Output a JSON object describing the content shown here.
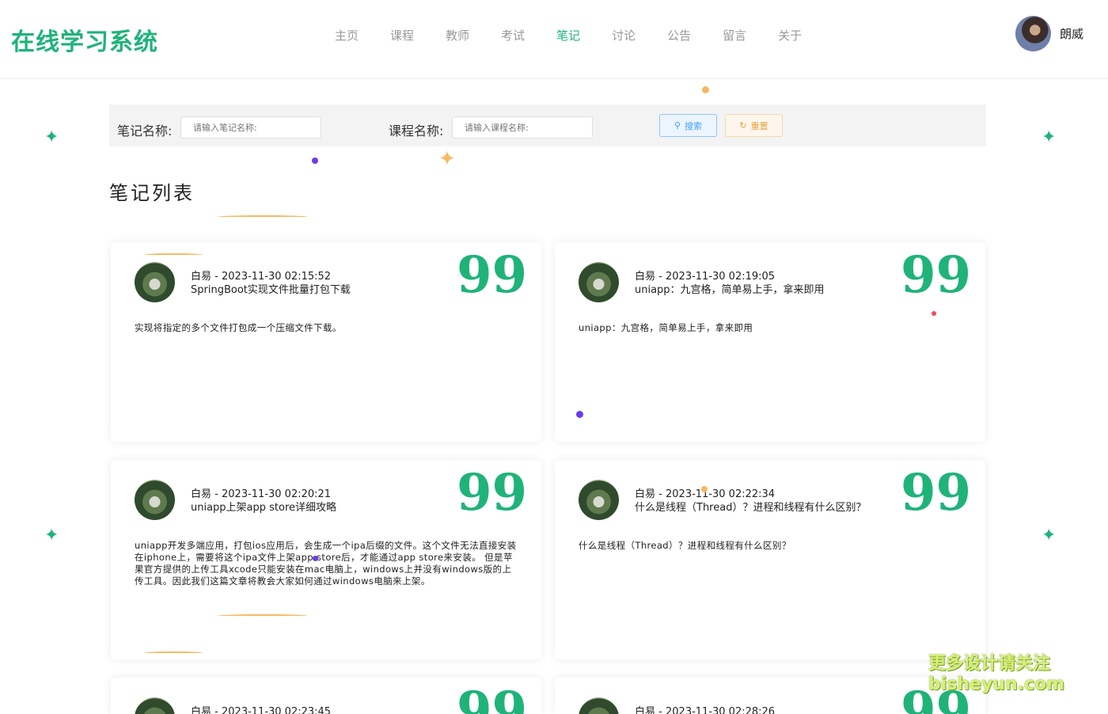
{
  "header": {
    "logo": "在线学习系统",
    "nav": [
      {
        "label": "主页",
        "active": false
      },
      {
        "label": "课程",
        "active": false
      },
      {
        "label": "教师",
        "active": false
      },
      {
        "label": "考试",
        "active": false
      },
      {
        "label": "笔记",
        "active": true
      },
      {
        "label": "讨论",
        "active": false
      },
      {
        "label": "公告",
        "active": false
      },
      {
        "label": "留言",
        "active": false
      },
      {
        "label": "关于",
        "active": false
      }
    ],
    "username": "朗威"
  },
  "search": {
    "note_label": "笔记名称:",
    "note_placeholder": "请输入笔记名称:",
    "course_label": "课程名称:",
    "course_placeholder": "请输入课程名称:",
    "search_button": "搜索",
    "reset_button": "重置"
  },
  "section_title": "笔记列表",
  "cards": [
    {
      "author": "白易",
      "time": "2023-11-30 02:15:52",
      "title": "SpringBoot实现文件批量打包下载",
      "content": "实现将指定的多个文件打包成一个压缩文件下载。"
    },
    {
      "author": "白易",
      "time": "2023-11-30 02:19:05",
      "title": "uniapp：九宫格，简单易上手，拿来即用",
      "content": "uniapp：九宫格，简单易上手，拿来即用"
    },
    {
      "author": "白易",
      "time": "2023-11-30 02:20:21",
      "title": "uniapp上架app store详细攻略",
      "content": "uniapp开发多端应用，打包ios应用后，会生成一个ipa后缀的文件。这个文件无法直接安装在iphone上，需要将这个ipa文件上架app store后，才能通过app store来安装。 但是苹果官方提供的上传工具xcode只能安装在mac电脑上，windows上并没有windows版的上传工具。因此我们这篇文章将教会大家如何通过windows电脑来上架。"
    },
    {
      "author": "白易",
      "time": "2023-11-30 02:22:34",
      "title": "什么是线程（Thread）？进程和线程有什么区别？",
      "content": "什么是线程（Thread）？进程和线程有什么区别？"
    },
    {
      "author": "白易",
      "time": "2023-11-30 02:23:45",
      "title": "",
      "content": ""
    },
    {
      "author": "白易",
      "time": "2023-11-30 02:28:26",
      "title": "",
      "content": ""
    }
  ],
  "separator": "-",
  "quote_glyph": "99",
  "watermark": {
    "line1": "更多设计请关注",
    "line2": "bisheyun.com"
  },
  "colors": {
    "accent": "#1fb37a",
    "search_btn": "#409eff",
    "reset_btn": "#e6a23c",
    "decor_orange": "#f5b95f",
    "decor_purple": "#6a3de8",
    "decor_red": "#f04a5a"
  }
}
